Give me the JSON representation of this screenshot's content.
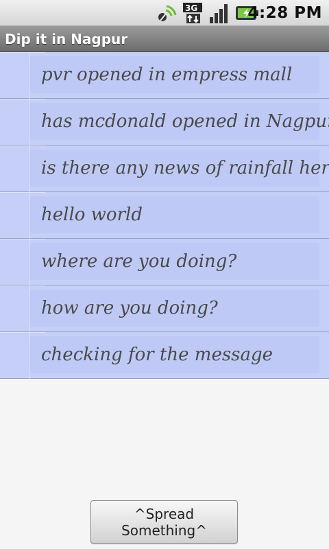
{
  "status_bar": {
    "time": "4:28 PM",
    "icons": [
      "sync-icon",
      "3g-data-icon",
      "signal-strength-icon",
      "battery-charging-icon"
    ],
    "network_label": "3G"
  },
  "app": {
    "title": "Dip it in Nagpur"
  },
  "messages": [
    {
      "text": "pvr opened in empress mall"
    },
    {
      "text": "has mcdonald opened in Nagpur"
    },
    {
      "text": "is there any news of rainfall here"
    },
    {
      "text": "hello world"
    },
    {
      "text": "where are you doing?"
    },
    {
      "text": "how are you doing?"
    },
    {
      "text": "checking for the message"
    }
  ],
  "actions": {
    "spread_label": "^Spread Something^"
  },
  "colors": {
    "list_background": "#c5cff8",
    "title_bar": "#7a7a7a",
    "battery_accent": "#7ac943"
  }
}
